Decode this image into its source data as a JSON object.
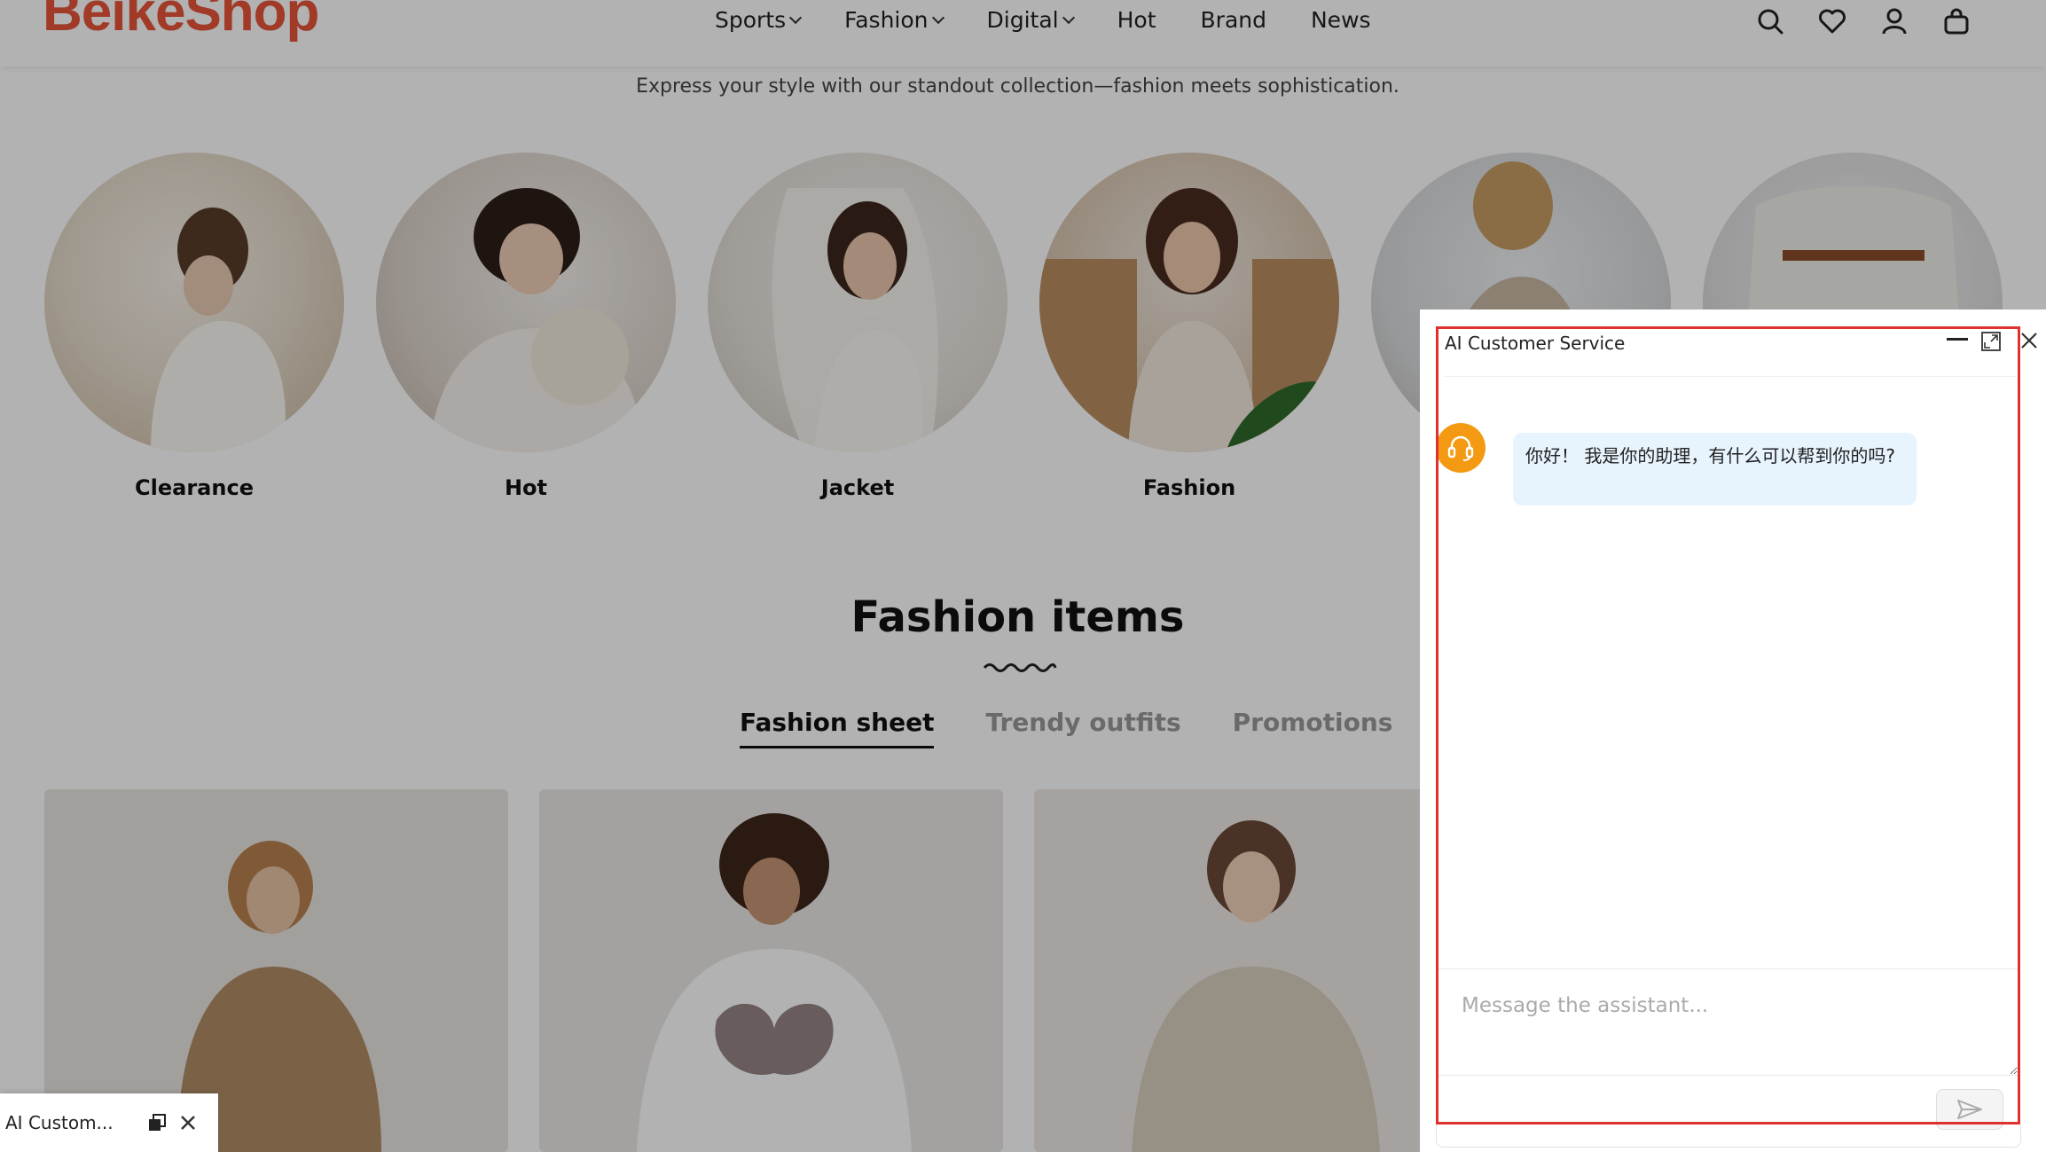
{
  "header": {
    "logo": "BeikeShop",
    "nav": [
      {
        "label": "Sports",
        "has_dropdown": true
      },
      {
        "label": "Fashion",
        "has_dropdown": true
      },
      {
        "label": "Digital",
        "has_dropdown": true
      },
      {
        "label": "Hot",
        "has_dropdown": false
      },
      {
        "label": "Brand",
        "has_dropdown": false
      },
      {
        "label": "News",
        "has_dropdown": false
      }
    ],
    "icons": [
      "search-icon",
      "heart-icon",
      "user-icon",
      "bag-icon"
    ]
  },
  "tagline": "Express your style with our standout collection—fashion meets sophistication.",
  "categories": [
    {
      "label": "Clearance"
    },
    {
      "label": "Hot"
    },
    {
      "label": "Jacket"
    },
    {
      "label": "Fashion"
    }
  ],
  "section": {
    "title": "Fashion items",
    "tabs": [
      {
        "label": "Fashion sheet",
        "active": true
      },
      {
        "label": "Trendy outfits",
        "active": false
      },
      {
        "label": "Promotions",
        "active": false
      }
    ]
  },
  "minimized_chat": {
    "title": "AI Custom..."
  },
  "chat": {
    "title": "AI Customer Service",
    "greeting": "你好！ 我是你的助理，有什么可以帮到你的吗?",
    "input_placeholder": "Message the assistant...",
    "accent_color": "#f39a12",
    "bubble_color": "#e7f3fd",
    "highlight_color": "#e03030"
  }
}
